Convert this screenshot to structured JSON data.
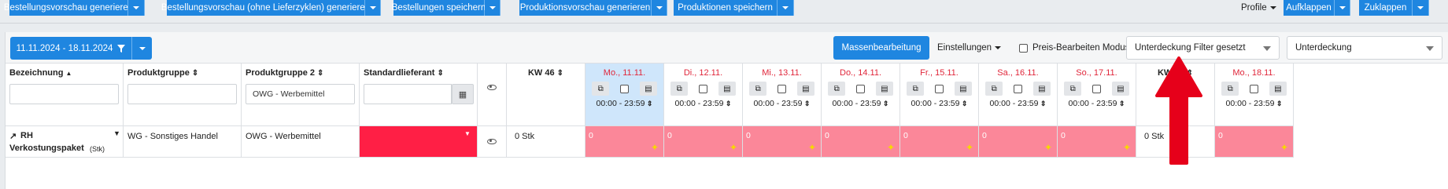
{
  "toolbar": {
    "buttons": [
      {
        "label": "Bestellungsvorschau generieren"
      },
      {
        "label": "Bestellungsvorschau (ohne Lieferzyklen) generieren"
      },
      {
        "label": "Bestellungen speichern"
      },
      {
        "label": "Produktionsvorschau generieren"
      },
      {
        "label": "Produktionen speichern"
      }
    ],
    "profile": "Profile",
    "expand": "Aufklappen",
    "collapse": "Zuklappen"
  },
  "filters": {
    "date_range": "11.11.2024 - 18.11.2024",
    "mass_edit": "Massenbearbeitung",
    "settings": "Einstellungen",
    "price_edit_mode": "Preis-Bearbeiten Modus",
    "shortfall_filter": "Unterdeckung Filter gesetzt",
    "shortfall_select": "Unterdeckung"
  },
  "columns": {
    "name": "Bezeichnung",
    "product_group": "Produktgruppe",
    "product_group2": "Produktgruppe 2",
    "supplier": "Standardlieferant",
    "product_group2_filter": "OWG - Werbemittel"
  },
  "days": [
    {
      "label": "KW 46",
      "kw": true
    },
    {
      "label": "Mo., 11.11.",
      "time": "00:00 - 23:59",
      "value": "0",
      "today": true
    },
    {
      "label": "Di., 12.11.",
      "time": "00:00 - 23:59",
      "value": "0"
    },
    {
      "label": "Mi., 13.11.",
      "time": "00:00 - 23:59",
      "value": "0"
    },
    {
      "label": "Do., 14.11.",
      "time": "00:00 - 23:59",
      "value": "0"
    },
    {
      "label": "Fr., 15.11.",
      "time": "00:00 - 23:59",
      "value": "0"
    },
    {
      "label": "Sa., 16.11.",
      "time": "00:00 - 23:59",
      "value": "0"
    },
    {
      "label": "So., 17.11.",
      "time": "00:00 - 23:59",
      "value": "0"
    },
    {
      "label": "KW 47",
      "kw": true
    },
    {
      "label": "Mo., 18.11.",
      "time": "00:00 - 23:59",
      "value": "0"
    }
  ],
  "row": {
    "name": "RH Verkostungspaket",
    "name_line1": "RH",
    "name_line2": "Verkostungspaket",
    "unit": "(Stk)",
    "product_group": "WG - Sonstiges Handel",
    "product_group2": "OWG - Werbemittel",
    "kw46_total": "0 Stk",
    "kw47_total": "0 Stk"
  },
  "colors": {
    "primary": "#1f86e0",
    "pink": "#fb8799",
    "supplier_red": "#ff1f45",
    "today": "#cfe6fb",
    "arrow": "#e6001a"
  }
}
